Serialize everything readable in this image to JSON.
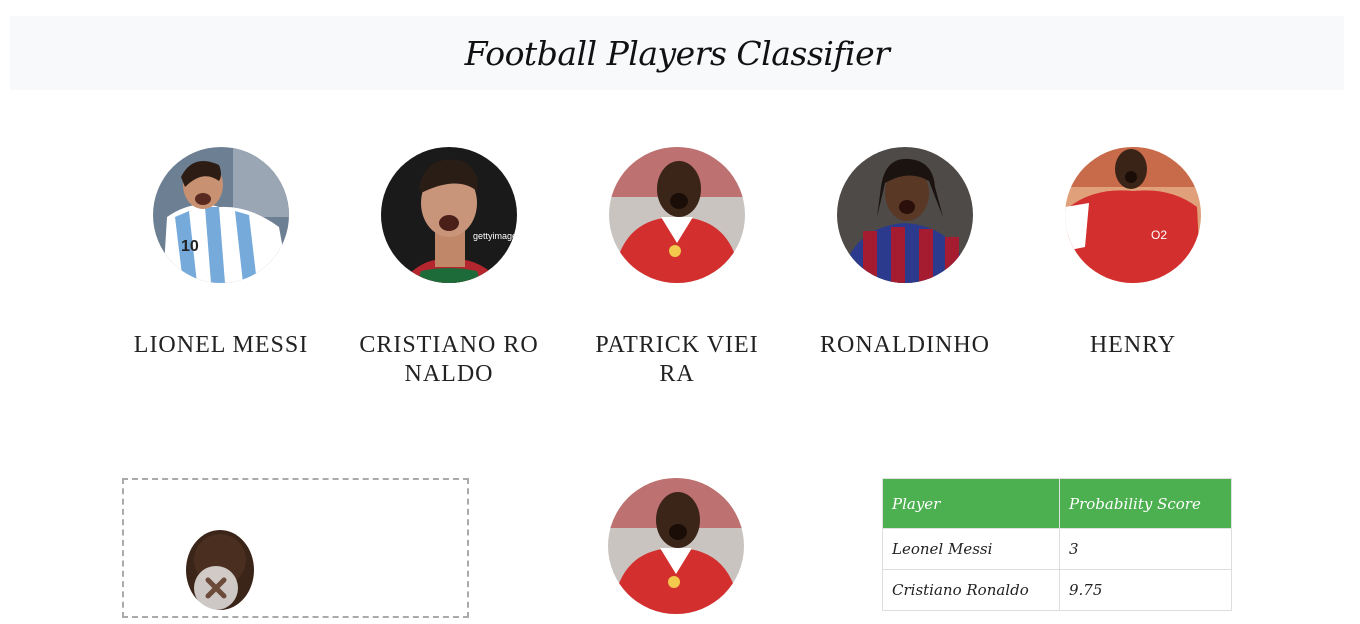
{
  "header": {
    "title": "Football Players Classifier"
  },
  "players": [
    {
      "name": "LIONEL MESSI",
      "kit": "argentina"
    },
    {
      "name": "CRISTIANO RONALDO",
      "kit": "portugal"
    },
    {
      "name": "PATRICK VIEIRA",
      "kit": "arsenal"
    },
    {
      "name": "RONALDINHO",
      "kit": "barcelona"
    },
    {
      "name": "HENRY",
      "kit": "arsenal"
    }
  ],
  "upload": {
    "remove_icon": "close-icon"
  },
  "result": {
    "kit": "arsenal"
  },
  "table": {
    "headers": [
      "Player",
      "Probability Score"
    ],
    "rows": [
      [
        "Leonel Messi",
        "3"
      ],
      [
        "Cristiano Ronaldo",
        "9.75"
      ]
    ]
  },
  "colors": {
    "header_bg": "#f8f9fa",
    "table_header_bg": "#4caf50",
    "arsenal_red": "#d32f2f",
    "argentina_blue": "#75aadb",
    "barca_blue": "#2b3a8c",
    "barca_red": "#a51c30"
  }
}
